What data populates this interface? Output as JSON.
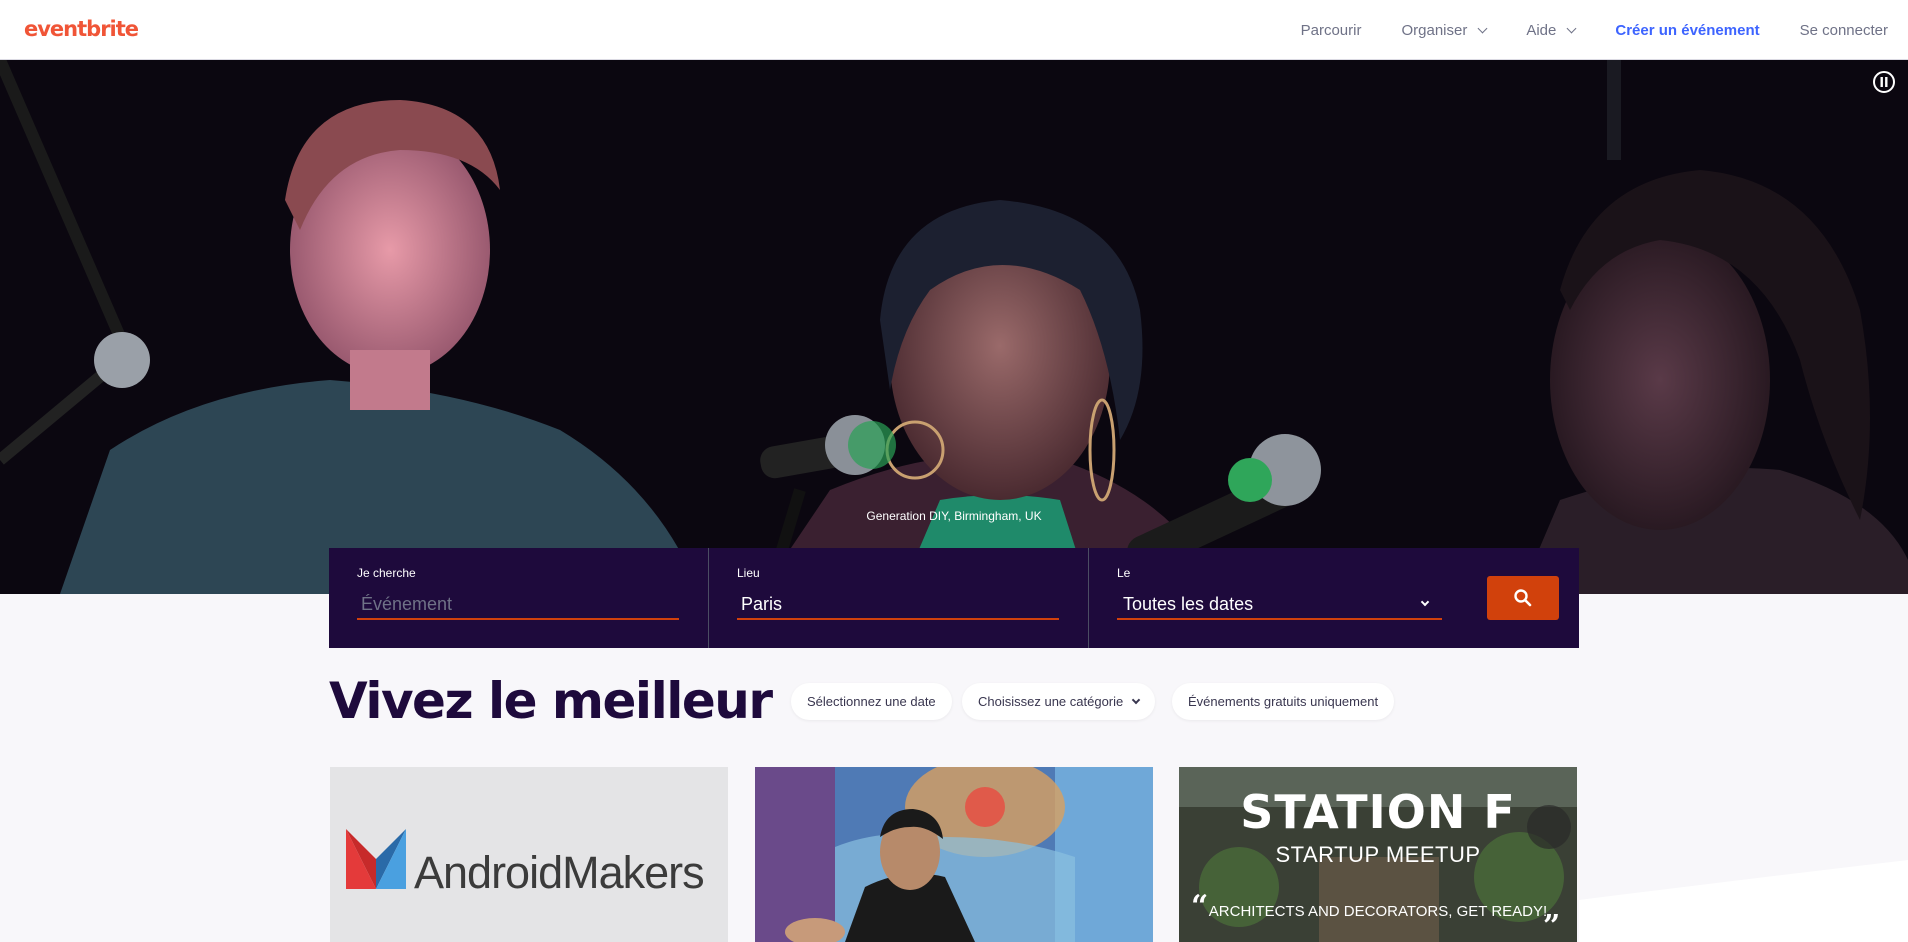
{
  "header": {
    "logo": "eventbrite",
    "nav": {
      "browse": "Parcourir",
      "organize": "Organiser",
      "help": "Aide",
      "create": "Créer un événement",
      "login": "Se connecter"
    }
  },
  "hero": {
    "caption": "Generation DIY, Birmingham, UK",
    "pause_icon": "pause-icon"
  },
  "search": {
    "what_label": "Je cherche",
    "what_placeholder": "Événement",
    "what_value": "",
    "where_label": "Lieu",
    "where_value": "Paris",
    "when_label": "Le",
    "when_value": "Toutes les dates",
    "button_icon": "search-icon"
  },
  "main": {
    "title": "Vivez le meilleur",
    "filters": {
      "date": "Sélectionnez une date",
      "category": "Choisissez une catégorie",
      "free": "Événements gratuits uniquement"
    }
  },
  "cards": [
    {
      "logo_text": "AndroidMakers"
    },
    {
      "logo_text": ""
    },
    {
      "title": "STATION F",
      "subtitle": "STARTUP MEETUP",
      "quote": "ARCHITECTS AND DECORATORS, GET READY!"
    }
  ],
  "colors": {
    "brand": "#f05537",
    "primary_dark": "#1e0a3c",
    "accent_orange": "#d1410c",
    "link_blue": "#3d64ff"
  }
}
